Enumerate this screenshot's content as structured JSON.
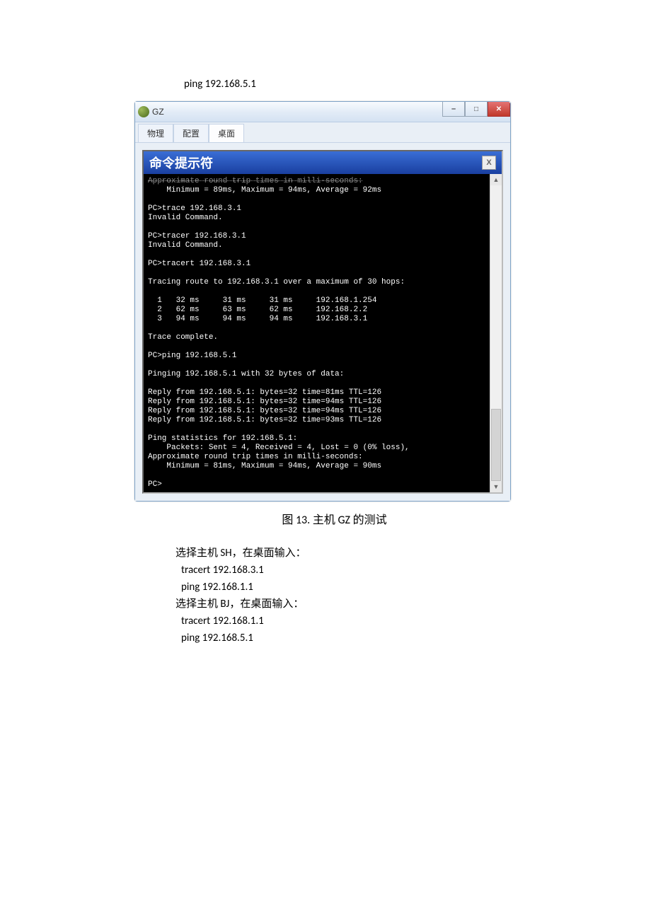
{
  "top_command": "ping   192.168.5.1",
  "window": {
    "title": "GZ",
    "tabs": {
      "t0": "物理",
      "t1": "配置",
      "t2": "桌面"
    },
    "console_title": "命令提示符",
    "console_close": "X"
  },
  "terminal": {
    "l00": "Approximate round trip times in milli-seconds:",
    "l01": "    Minimum = 89ms, Maximum = 94ms, Average = 92ms",
    "l02": "",
    "l03": "PC>trace 192.168.3.1",
    "l04": "Invalid Command.",
    "l05": "",
    "l06": "PC>tracer 192.168.3.1",
    "l07": "Invalid Command.",
    "l08": "",
    "l09": "PC>tracert 192.168.3.1",
    "l10": "",
    "l11": "Tracing route to 192.168.3.1 over a maximum of 30 hops:",
    "l12": "",
    "l13": "  1   32 ms     31 ms     31 ms     192.168.1.254",
    "l14": "  2   62 ms     63 ms     62 ms     192.168.2.2",
    "l15": "  3   94 ms     94 ms     94 ms     192.168.3.1",
    "l16": "",
    "l17": "Trace complete.",
    "l18": "",
    "l19": "PC>ping 192.168.5.1",
    "l20": "",
    "l21": "Pinging 192.168.5.1 with 32 bytes of data:",
    "l22": "",
    "l23": "Reply from 192.168.5.1: bytes=32 time=81ms TTL=126",
    "l24": "Reply from 192.168.5.1: bytes=32 time=94ms TTL=126",
    "l25": "Reply from 192.168.5.1: bytes=32 time=94ms TTL=126",
    "l26": "Reply from 192.168.5.1: bytes=32 time=93ms TTL=126",
    "l27": "",
    "l28": "Ping statistics for 192.168.5.1:",
    "l29": "    Packets: Sent = 4, Received = 4, Lost = 0 (0% loss),",
    "l30": "Approximate round trip times in milli-seconds:",
    "l31": "    Minimum = 81ms, Maximum = 94ms, Average = 90ms",
    "l32": "",
    "l33": "PC>"
  },
  "caption": "图 13.   主机 GZ 的测试",
  "body": {
    "p1": "选择主机 SH，在桌面输入：",
    "c1": "tracert 192.168.3.1",
    "c2": "ping   192.168.1.1",
    "p2": "选择主机 BJ，在桌面输入：",
    "c3": "tracert 192.168.1.1",
    "c4": "ping   192.168.5.1"
  }
}
